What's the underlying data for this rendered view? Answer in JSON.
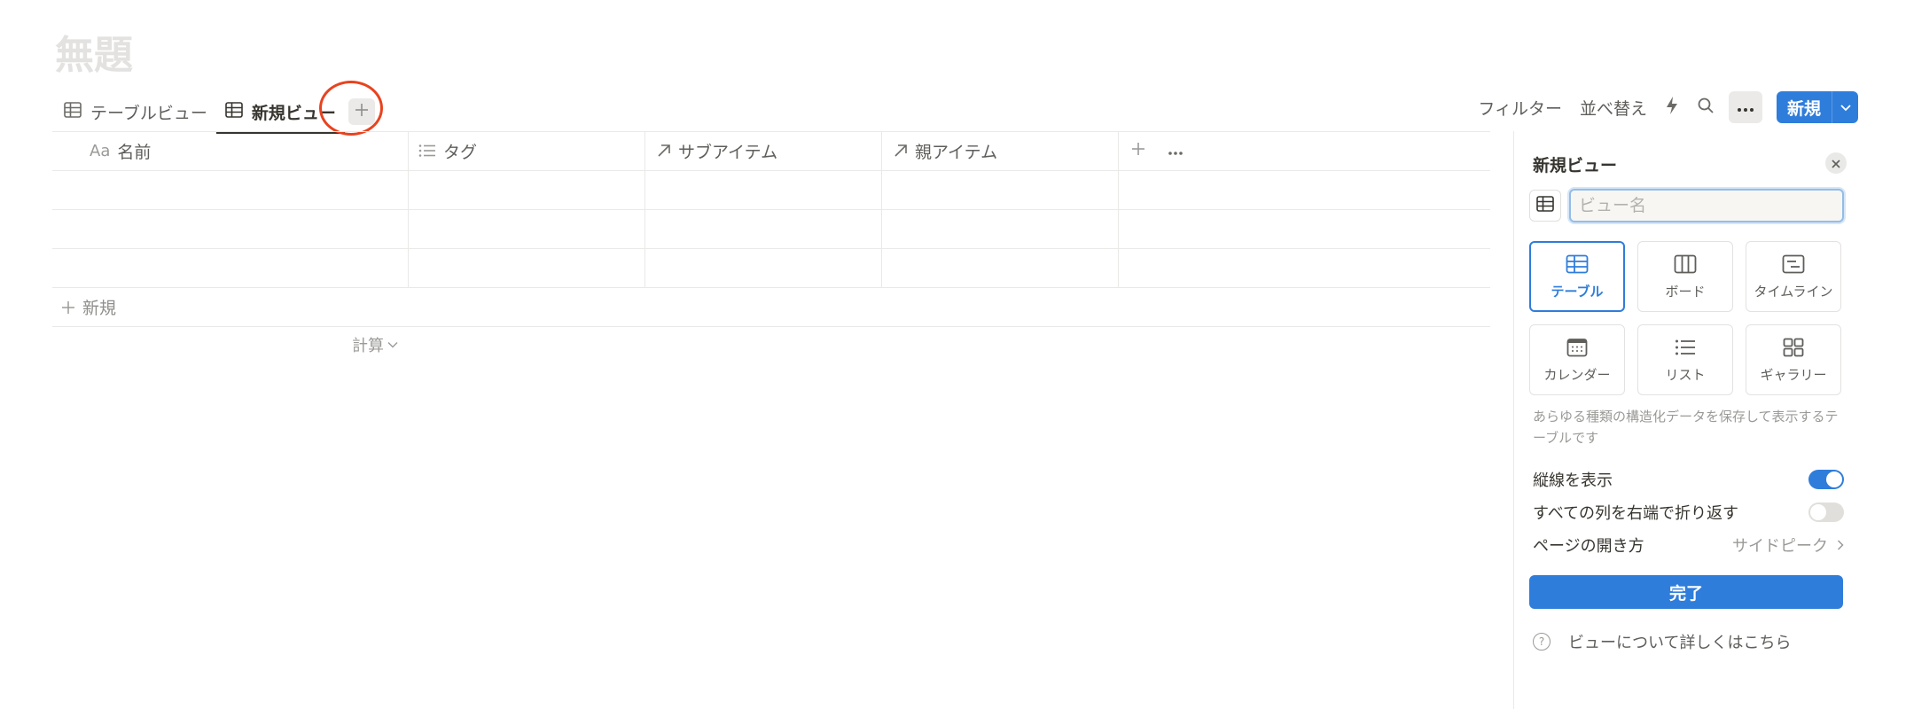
{
  "page": {
    "title": "無題"
  },
  "tabs": [
    {
      "label": "テーブルビュー",
      "icon": "table-icon",
      "active": false
    },
    {
      "label": "新規ビュー",
      "icon": "table-icon",
      "active": true
    }
  ],
  "toolbar": {
    "filter_label": "フィルター",
    "sort_label": "並べ替え",
    "new_label": "新規"
  },
  "table": {
    "columns": [
      {
        "label": "名前",
        "icon_text": "Aa"
      },
      {
        "label": "タグ",
        "icon": "list-icon"
      },
      {
        "label": "サブアイテム",
        "icon": "arrow-up-right-icon"
      },
      {
        "label": "親アイテム",
        "icon": "arrow-up-right-icon"
      }
    ],
    "add_row_label": "新規",
    "calculate_label": "計算"
  },
  "panel": {
    "title": "新規ビュー",
    "name_placeholder": "ビュー名",
    "view_types": [
      {
        "label": "テーブル",
        "icon": "table-icon",
        "selected": true
      },
      {
        "label": "ボード",
        "icon": "board-icon",
        "selected": false
      },
      {
        "label": "タイムライン",
        "icon": "timeline-icon",
        "selected": false
      },
      {
        "label": "カレンダー",
        "icon": "calendar-icon",
        "selected": false
      },
      {
        "label": "リスト",
        "icon": "list-icon",
        "selected": false
      },
      {
        "label": "ギャラリー",
        "icon": "gallery-icon",
        "selected": false
      }
    ],
    "description": "あらゆる種類の構造化データを保存して表示するテーブルです",
    "settings": [
      {
        "label": "縦線を表示",
        "type": "toggle",
        "value": true
      },
      {
        "label": "すべての列を右端で折り返す",
        "type": "toggle",
        "value": false
      },
      {
        "label": "ページの開き方",
        "type": "select",
        "value": "サイドピーク"
      }
    ],
    "done_label": "完了",
    "help_label": "ビューについて詳しくはこちら"
  },
  "colors": {
    "accent": "#2f7ddb",
    "highlight": "#e8431f"
  }
}
